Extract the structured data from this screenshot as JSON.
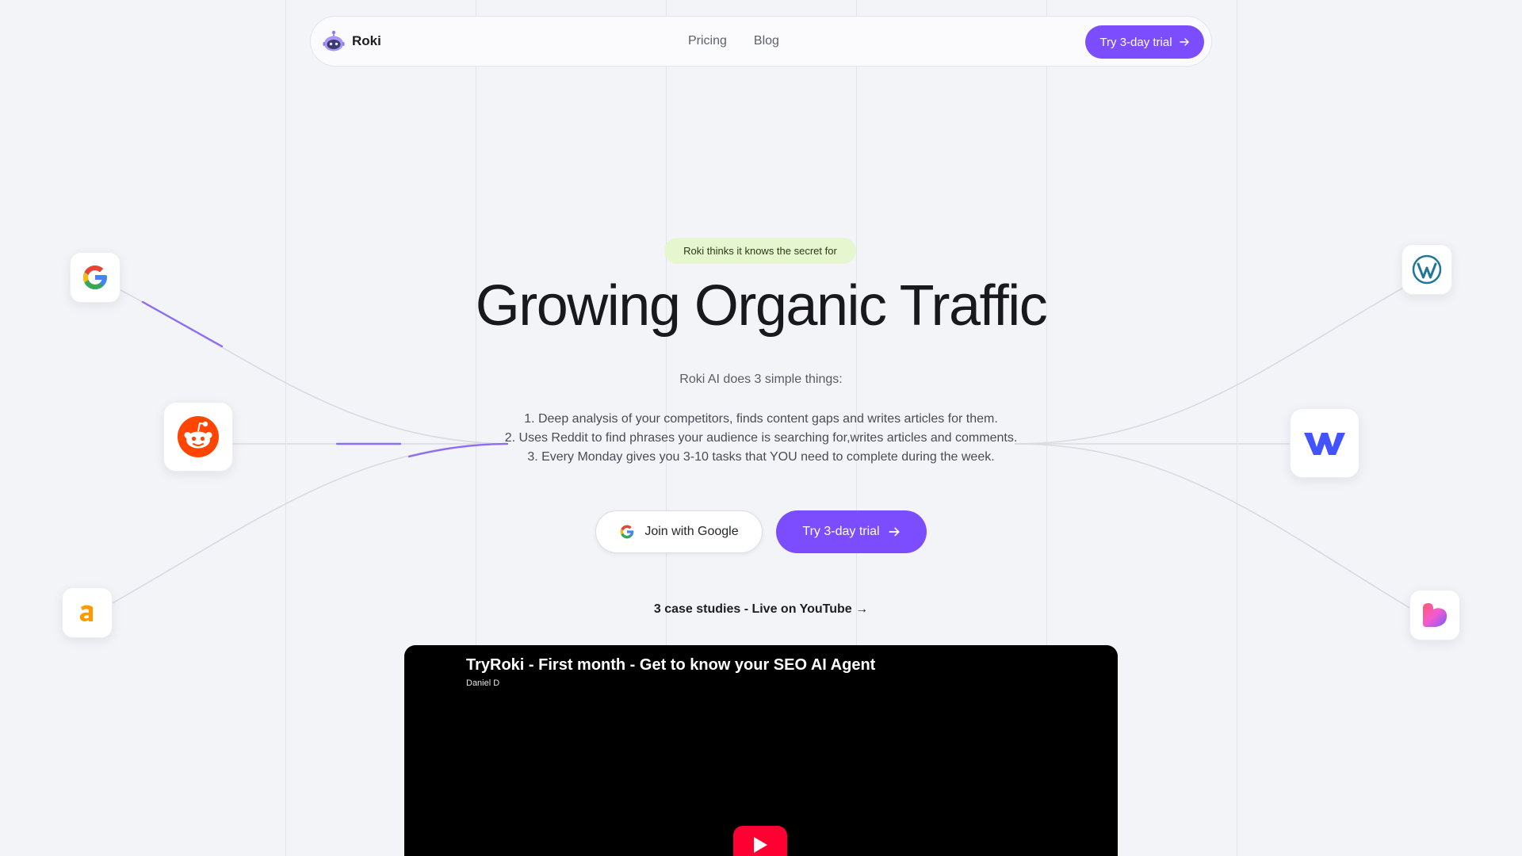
{
  "nav": {
    "brand": "Roki",
    "links": [
      "Pricing",
      "Blog"
    ],
    "cta_label": "Try 3-day trial"
  },
  "hero": {
    "badge": "Roki thinks it knows the secret for",
    "title": "Growing Organic Traffic",
    "subtitle": "Roki AI does 3 simple things:",
    "steps": [
      "1. Deep analysis of your competitors, finds content gaps and writes articles for them.",
      "2. Uses Reddit to find phrases your audience is searching for,writes articles and comments.",
      "3. Every Monday gives you 3-10 tasks that YOU need to complete during the week."
    ],
    "google_button": "Join with Google",
    "trial_button": "Try 3-day trial",
    "case_studies_link": "3 case studies - Live on YouTube →"
  },
  "video": {
    "title": "TryRoki - First month - Get to know your SEO AI Agent",
    "channel": "Daniel D"
  },
  "integrations": {
    "left": [
      "google-icon",
      "reddit-icon",
      "amazon-icon"
    ],
    "right": [
      "wordpress-icon",
      "webflow-icon",
      "heart-app-icon"
    ]
  },
  "colors": {
    "accent": "#7c4dff",
    "background": "#f3f4f8",
    "badge_bg": "#e6f6cf",
    "reddit": "#ff4500",
    "amazon": "#ff9900",
    "webflow": "#4353ff",
    "wordpress": "#21759b",
    "youtube": "#ff0033"
  }
}
